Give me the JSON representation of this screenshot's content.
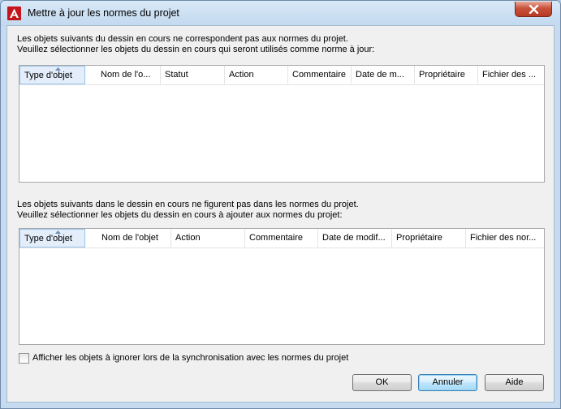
{
  "window": {
    "title": "Mettre à jour les normes du projet"
  },
  "section1": {
    "line1": "Les objets suivants du dessin en cours ne correspondent pas aux normes du projet.",
    "line2": "Veuillez sélectionner les objets du dessin en cours qui seront utilisés comme norme à jour:",
    "columns": [
      "Type d'objet",
      "Nom de l'o...",
      "Statut",
      "Action",
      "Commentaire",
      "Date de m...",
      "Propriétaire",
      "Fichier des ..."
    ]
  },
  "section2": {
    "line1": "Les objets suivants dans le dessin en cours ne figurent pas dans les normes du projet.",
    "line2": "Veuillez sélectionner les objets du dessin en cours à ajouter aux normes du projet:",
    "columns": [
      "Type d'objet",
      "Nom de l'objet",
      "Action",
      "Commentaire",
      "Date de modif...",
      "Propriétaire",
      "Fichier des nor..."
    ]
  },
  "checkbox": {
    "label": "Afficher les objets à ignorer lors de la synchronisation avec les normes du projet",
    "checked": false
  },
  "buttons": {
    "ok": "OK",
    "cancel": "Annuler",
    "help": "Aide"
  },
  "icons": {
    "app": "autocad-logo-icon",
    "close": "close-icon",
    "sort": "sort-ascending-icon"
  }
}
